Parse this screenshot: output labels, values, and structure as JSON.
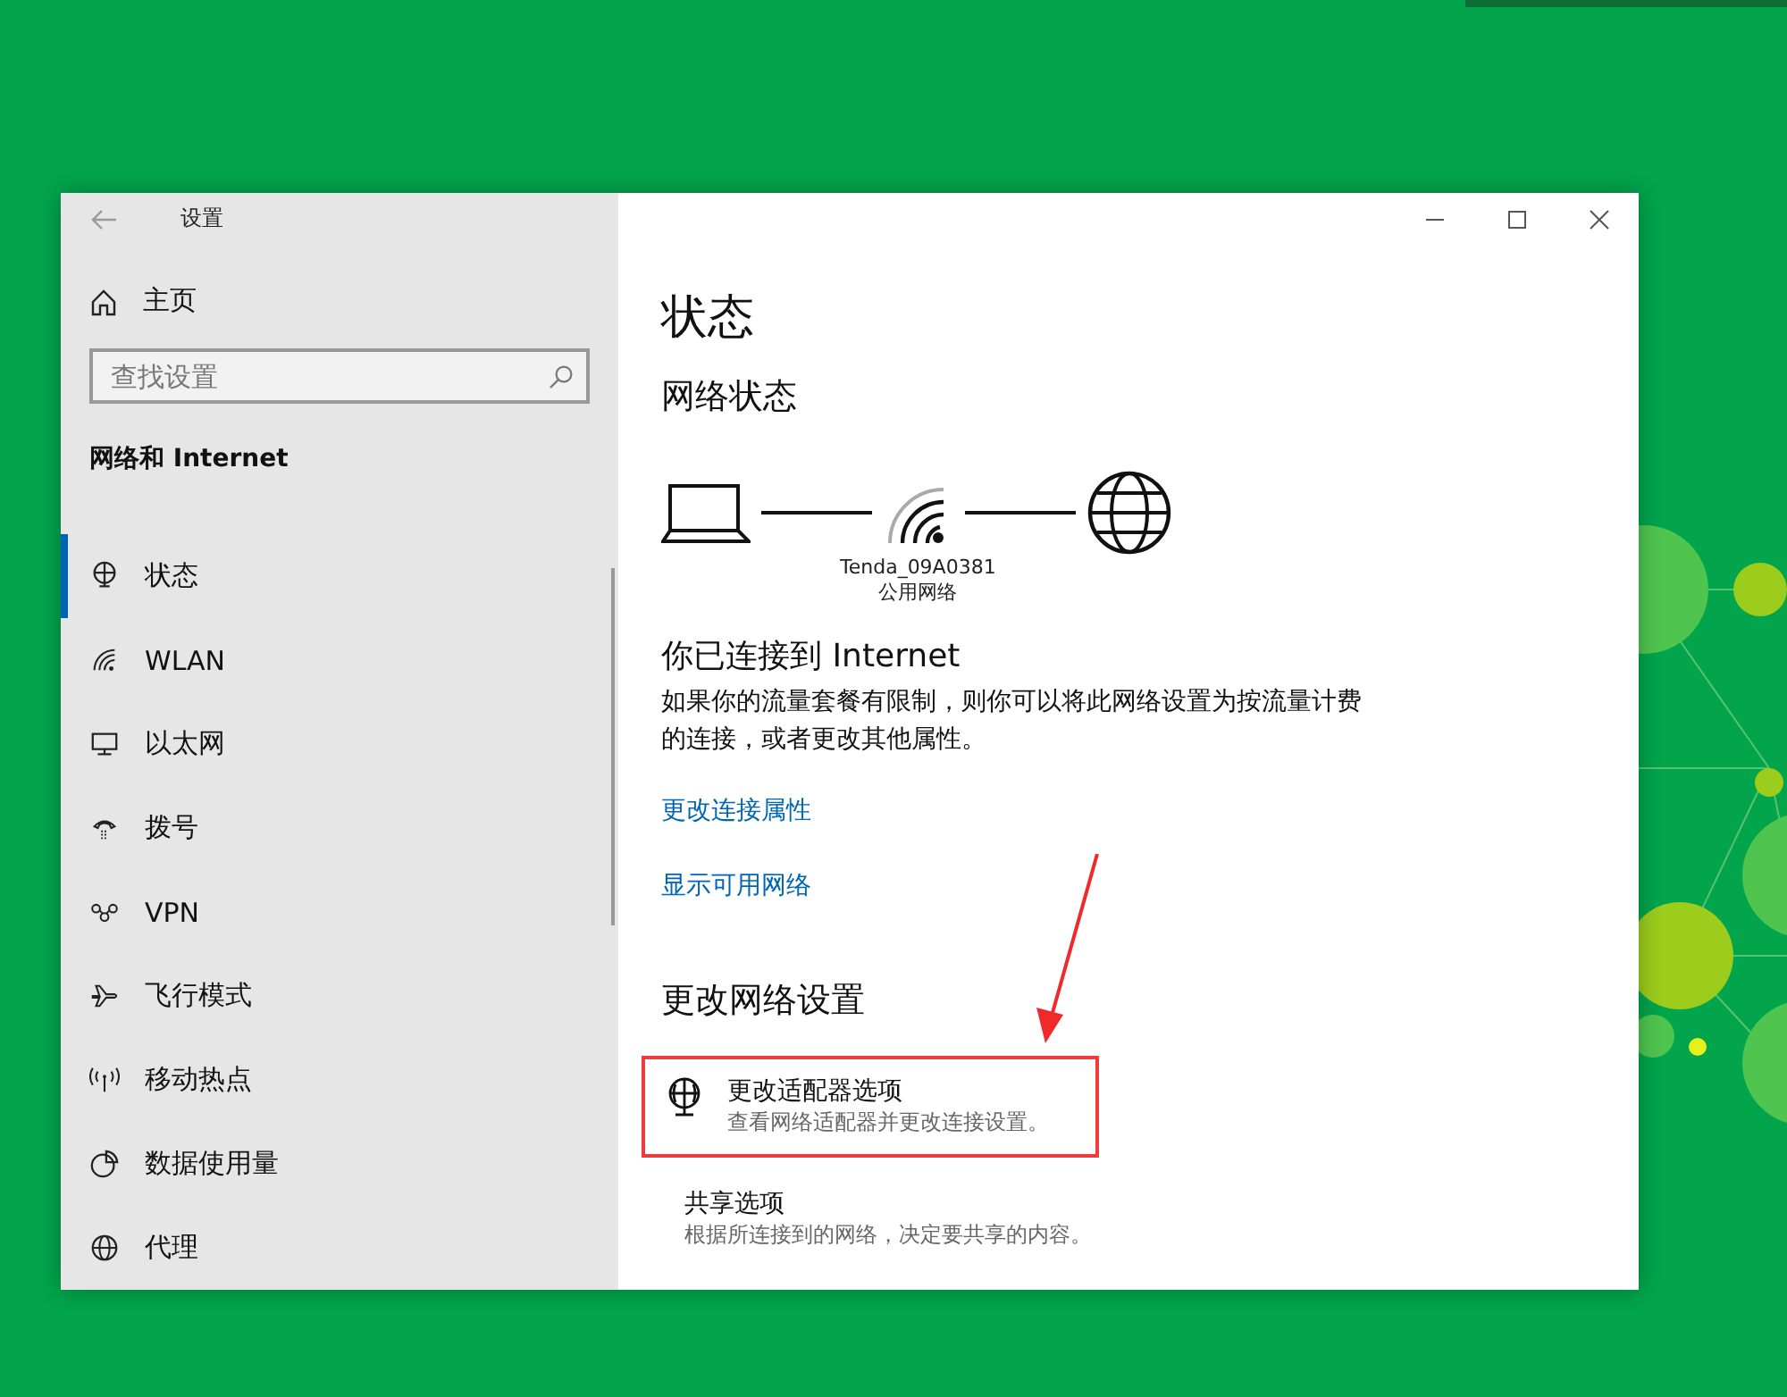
{
  "window": {
    "title": "设置"
  },
  "sidebar": {
    "home": "主页",
    "search": {
      "placeholder": "查找设置"
    },
    "section": "网络和 Internet",
    "items": [
      {
        "kind": "status",
        "label": "状态",
        "selected": true
      },
      {
        "kind": "wlan",
        "label": "WLAN",
        "selected": false
      },
      {
        "kind": "ethernet",
        "label": "以太网",
        "selected": false
      },
      {
        "kind": "dialup",
        "label": "拨号",
        "selected": false
      },
      {
        "kind": "vpn",
        "label": "VPN",
        "selected": false
      },
      {
        "kind": "airplane",
        "label": "飞行模式",
        "selected": false
      },
      {
        "kind": "hotspot",
        "label": "移动热点",
        "selected": false
      },
      {
        "kind": "data",
        "label": "数据使用量",
        "selected": false
      },
      {
        "kind": "proxy",
        "label": "代理",
        "selected": false
      }
    ]
  },
  "content": {
    "title": "状态",
    "network_status": {
      "heading": "网络状态",
      "network_name": "Tenda_09A0381",
      "network_type": "公用网络"
    },
    "connected": {
      "heading": "你已连接到 Internet",
      "description": "如果你的流量套餐有限制，则你可以将此网络设置为按流量计费的连接，或者更改其他属性。"
    },
    "links": [
      "更改连接属性",
      "显示可用网络"
    ],
    "change_heading": "更改网络设置",
    "options": [
      {
        "kind": "adapter",
        "title": "更改适配器选项",
        "description": "查看网络适配器并更改连接设置。",
        "highlighted": true
      },
      {
        "kind": "sharing",
        "title": "共享选项",
        "description": "根据所连接到的网络，决定要共享的内容。",
        "highlighted": false
      }
    ]
  }
}
